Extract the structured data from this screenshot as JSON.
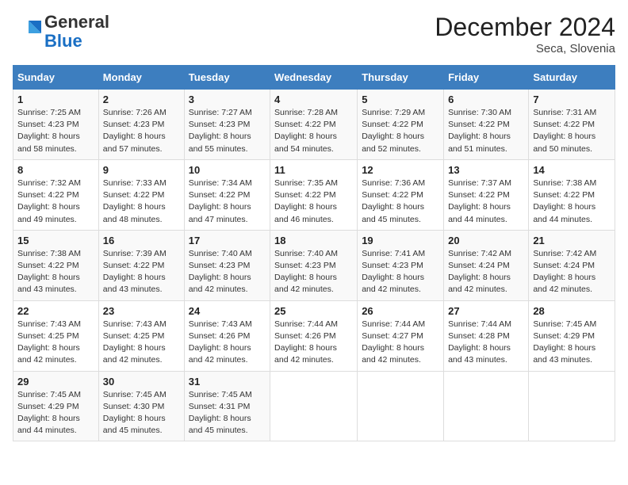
{
  "logo": {
    "line1": "General",
    "line2": "Blue"
  },
  "title": "December 2024",
  "location": "Seca, Slovenia",
  "days_of_week": [
    "Sunday",
    "Monday",
    "Tuesday",
    "Wednesday",
    "Thursday",
    "Friday",
    "Saturday"
  ],
  "weeks": [
    [
      {
        "day": "1",
        "sunrise": "7:25 AM",
        "sunset": "4:23 PM",
        "daylight": "8 hours and 58 minutes."
      },
      {
        "day": "2",
        "sunrise": "7:26 AM",
        "sunset": "4:23 PM",
        "daylight": "8 hours and 57 minutes."
      },
      {
        "day": "3",
        "sunrise": "7:27 AM",
        "sunset": "4:23 PM",
        "daylight": "8 hours and 55 minutes."
      },
      {
        "day": "4",
        "sunrise": "7:28 AM",
        "sunset": "4:22 PM",
        "daylight": "8 hours and 54 minutes."
      },
      {
        "day": "5",
        "sunrise": "7:29 AM",
        "sunset": "4:22 PM",
        "daylight": "8 hours and 52 minutes."
      },
      {
        "day": "6",
        "sunrise": "7:30 AM",
        "sunset": "4:22 PM",
        "daylight": "8 hours and 51 minutes."
      },
      {
        "day": "7",
        "sunrise": "7:31 AM",
        "sunset": "4:22 PM",
        "daylight": "8 hours and 50 minutes."
      }
    ],
    [
      {
        "day": "8",
        "sunrise": "7:32 AM",
        "sunset": "4:22 PM",
        "daylight": "8 hours and 49 minutes."
      },
      {
        "day": "9",
        "sunrise": "7:33 AM",
        "sunset": "4:22 PM",
        "daylight": "8 hours and 48 minutes."
      },
      {
        "day": "10",
        "sunrise": "7:34 AM",
        "sunset": "4:22 PM",
        "daylight": "8 hours and 47 minutes."
      },
      {
        "day": "11",
        "sunrise": "7:35 AM",
        "sunset": "4:22 PM",
        "daylight": "8 hours and 46 minutes."
      },
      {
        "day": "12",
        "sunrise": "7:36 AM",
        "sunset": "4:22 PM",
        "daylight": "8 hours and 45 minutes."
      },
      {
        "day": "13",
        "sunrise": "7:37 AM",
        "sunset": "4:22 PM",
        "daylight": "8 hours and 44 minutes."
      },
      {
        "day": "14",
        "sunrise": "7:38 AM",
        "sunset": "4:22 PM",
        "daylight": "8 hours and 44 minutes."
      }
    ],
    [
      {
        "day": "15",
        "sunrise": "7:38 AM",
        "sunset": "4:22 PM",
        "daylight": "8 hours and 43 minutes."
      },
      {
        "day": "16",
        "sunrise": "7:39 AM",
        "sunset": "4:22 PM",
        "daylight": "8 hours and 43 minutes."
      },
      {
        "day": "17",
        "sunrise": "7:40 AM",
        "sunset": "4:23 PM",
        "daylight": "8 hours and 42 minutes."
      },
      {
        "day": "18",
        "sunrise": "7:40 AM",
        "sunset": "4:23 PM",
        "daylight": "8 hours and 42 minutes."
      },
      {
        "day": "19",
        "sunrise": "7:41 AM",
        "sunset": "4:23 PM",
        "daylight": "8 hours and 42 minutes."
      },
      {
        "day": "20",
        "sunrise": "7:42 AM",
        "sunset": "4:24 PM",
        "daylight": "8 hours and 42 minutes."
      },
      {
        "day": "21",
        "sunrise": "7:42 AM",
        "sunset": "4:24 PM",
        "daylight": "8 hours and 42 minutes."
      }
    ],
    [
      {
        "day": "22",
        "sunrise": "7:43 AM",
        "sunset": "4:25 PM",
        "daylight": "8 hours and 42 minutes."
      },
      {
        "day": "23",
        "sunrise": "7:43 AM",
        "sunset": "4:25 PM",
        "daylight": "8 hours and 42 minutes."
      },
      {
        "day": "24",
        "sunrise": "7:43 AM",
        "sunset": "4:26 PM",
        "daylight": "8 hours and 42 minutes."
      },
      {
        "day": "25",
        "sunrise": "7:44 AM",
        "sunset": "4:26 PM",
        "daylight": "8 hours and 42 minutes."
      },
      {
        "day": "26",
        "sunrise": "7:44 AM",
        "sunset": "4:27 PM",
        "daylight": "8 hours and 42 minutes."
      },
      {
        "day": "27",
        "sunrise": "7:44 AM",
        "sunset": "4:28 PM",
        "daylight": "8 hours and 43 minutes."
      },
      {
        "day": "28",
        "sunrise": "7:45 AM",
        "sunset": "4:29 PM",
        "daylight": "8 hours and 43 minutes."
      }
    ],
    [
      {
        "day": "29",
        "sunrise": "7:45 AM",
        "sunset": "4:29 PM",
        "daylight": "8 hours and 44 minutes."
      },
      {
        "day": "30",
        "sunrise": "7:45 AM",
        "sunset": "4:30 PM",
        "daylight": "8 hours and 45 minutes."
      },
      {
        "day": "31",
        "sunrise": "7:45 AM",
        "sunset": "4:31 PM",
        "daylight": "8 hours and 45 minutes."
      },
      null,
      null,
      null,
      null
    ]
  ]
}
